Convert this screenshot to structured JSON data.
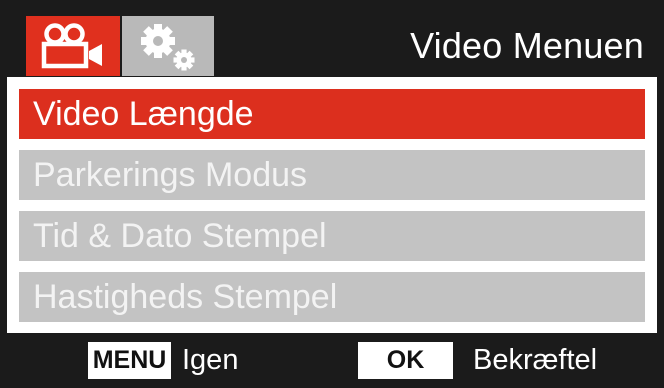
{
  "header": {
    "title": "Video Menuen",
    "tabs": [
      {
        "icon": "video-camera-icon",
        "active": true
      },
      {
        "icon": "gears-icon",
        "active": false
      }
    ]
  },
  "menu": {
    "items": [
      {
        "label": "Video Længde",
        "selected": true
      },
      {
        "label": "Parkerings Modus",
        "selected": false
      },
      {
        "label": "Tid & Dato Stempel",
        "selected": false
      },
      {
        "label": "Hastigheds Stempel",
        "selected": false
      }
    ]
  },
  "footer": {
    "menu_key": "MENU",
    "menu_hint": "Igen",
    "ok_key": "OK",
    "ok_hint": "Bekræftel"
  },
  "colors": {
    "accent": "#e0301e",
    "inactive_item": "#c3c3c3",
    "background": "#1b1b1b"
  }
}
